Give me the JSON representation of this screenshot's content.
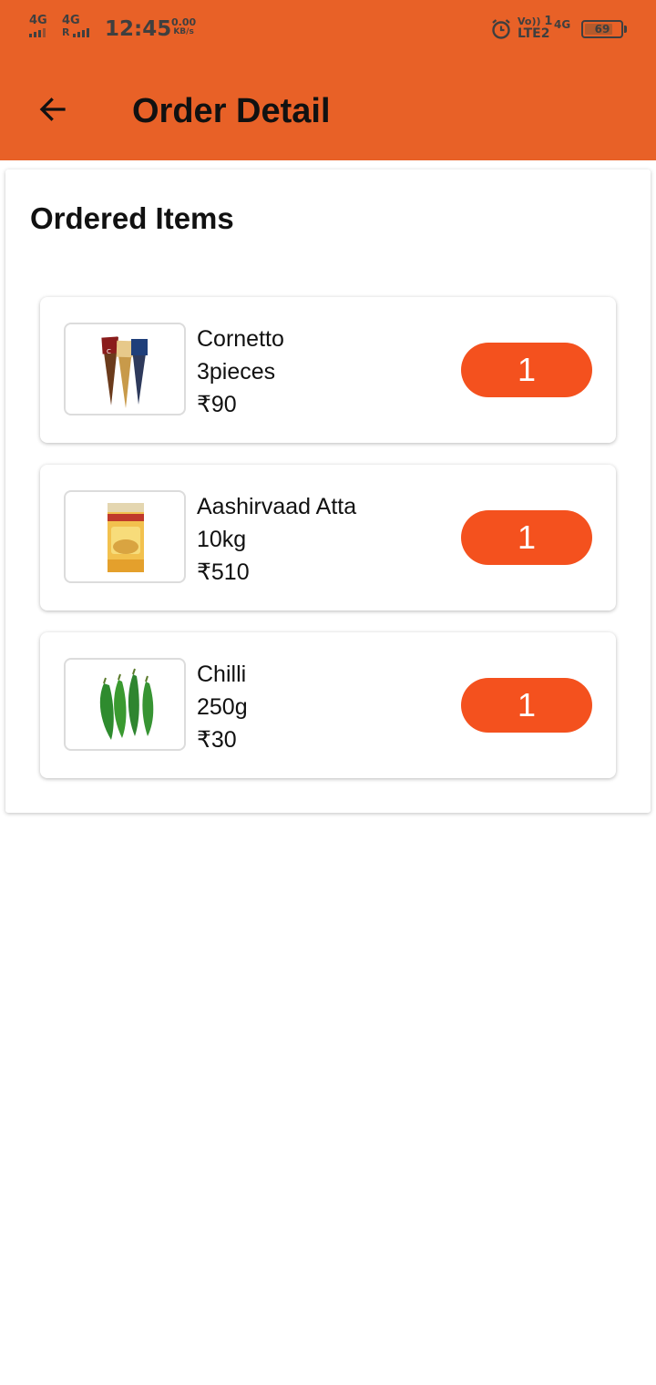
{
  "status_bar": {
    "sim1_network": "4G",
    "sim2_network": "4G",
    "sim2_roaming": "R",
    "time": "12:45",
    "speed_value": "0.00",
    "speed_unit": "KB/s",
    "volte_label": "Vo))",
    "lte_label": "LTE2",
    "sim_slot": "1",
    "network_right": "4G",
    "battery": "69"
  },
  "header": {
    "title": "Order Detail",
    "background_color": "#e86127"
  },
  "section": {
    "title": "Ordered Items"
  },
  "items": [
    {
      "name": "Cornetto",
      "quantity_desc": "3pieces",
      "price": "₹90",
      "count": "1",
      "image_icon": "cornetto-cones-image"
    },
    {
      "name": "Aashirvaad Atta",
      "quantity_desc": "10kg",
      "price": "₹510",
      "count": "1",
      "image_icon": "atta-bag-image"
    },
    {
      "name": "Chilli",
      "quantity_desc": "250g",
      "price": "₹30",
      "count": "1",
      "image_icon": "green-chilli-image"
    }
  ],
  "colors": {
    "accent": "#f4511e"
  }
}
